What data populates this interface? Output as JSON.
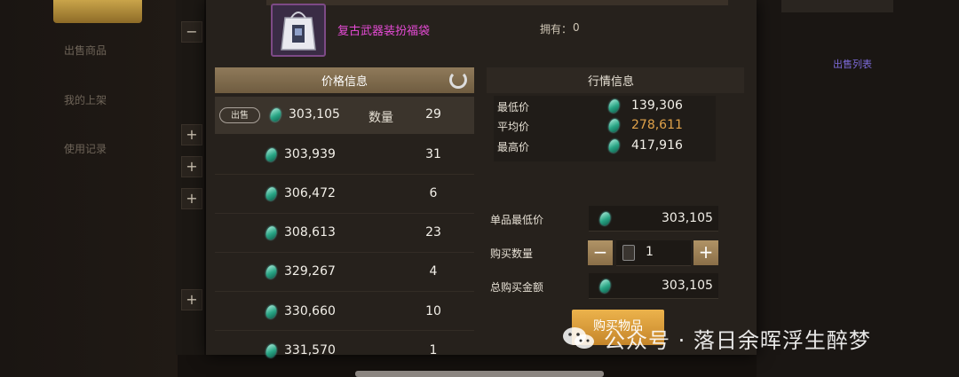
{
  "background": {
    "menu_items": [
      "出售商品",
      "我的上架",
      "使用记录"
    ],
    "right_tab": "出售列表"
  },
  "item": {
    "name": "复古武器装扮福袋",
    "own_label": "拥有：",
    "own_value": "0"
  },
  "price_info": {
    "title": "价格信息",
    "sell_badge": "出售",
    "qty_header": "数量",
    "rows": [
      {
        "price": "303,105",
        "qty": "29"
      },
      {
        "price": "303,939",
        "qty": "31"
      },
      {
        "price": "306,472",
        "qty": "6"
      },
      {
        "price": "308,613",
        "qty": "23"
      },
      {
        "price": "329,267",
        "qty": "4"
      },
      {
        "price": "330,660",
        "qty": "10"
      },
      {
        "price": "331,570",
        "qty": "1"
      }
    ]
  },
  "market": {
    "title": "行情信息",
    "lowest_label": "最低价",
    "lowest_value": "139,306",
    "average_label": "平均价",
    "average_value": "278,611",
    "highest_label": "最高价",
    "highest_value": "417,916",
    "unit_lowest_label": "单品最低价",
    "unit_lowest_value": "303,105",
    "buy_qty_label": "购买数量",
    "buy_qty_value": "1",
    "total_label": "总购买金额",
    "total_value": "303,105",
    "buy_button": "购买物品"
  },
  "watermark": "公众号 · 落日余晖浮生醉梦",
  "colors": {
    "item_name": "#e64bd6",
    "gem": "#29a585",
    "average_value": "#e0a24a",
    "buy_button": "#e0a040"
  }
}
